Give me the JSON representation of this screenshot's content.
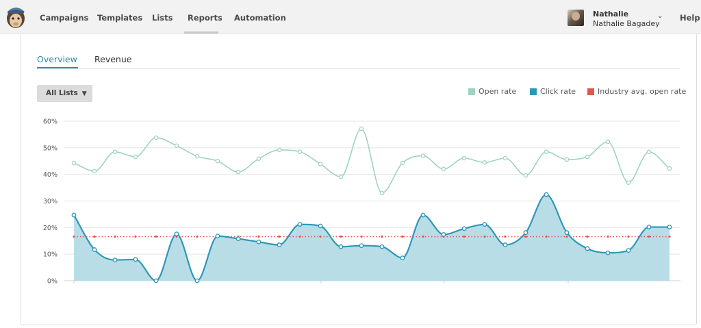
{
  "nav": {
    "items": [
      {
        "label": "Campaigns"
      },
      {
        "label": "Templates"
      },
      {
        "label": "Lists"
      },
      {
        "label": "Reports"
      },
      {
        "label": "Automation"
      }
    ],
    "active": "Reports",
    "help_label": "Help"
  },
  "user": {
    "first_name": "Nathalie",
    "full_name": "Nathalie Bagadey"
  },
  "tabs": [
    {
      "label": "Overview",
      "active": true
    },
    {
      "label": "Revenue",
      "active": false
    }
  ],
  "filter": {
    "selected": "All Lists"
  },
  "colors": {
    "open_rate": "#9fd3c1",
    "click_rate": "#2e97b7",
    "click_fill": "#b9dde7",
    "industry": "#e2574c",
    "accent": "#2f87a0"
  },
  "chart_data": {
    "type": "line",
    "title": "",
    "xlabel": "",
    "ylabel": "",
    "ylim": [
      0,
      60
    ],
    "yticks": [
      "0%",
      "10%",
      "20%",
      "30%",
      "40%",
      "50%",
      "60%"
    ],
    "grid": true,
    "legend_placement": "top-right",
    "x": [
      1,
      2,
      3,
      4,
      5,
      6,
      7,
      8,
      9,
      10,
      11,
      12,
      13,
      14,
      15,
      16,
      17,
      18,
      19,
      20,
      21,
      22,
      23,
      24,
      25,
      26,
      27,
      28,
      29,
      30
    ],
    "series": [
      {
        "name": "Open rate",
        "style": "line",
        "values": [
          44.3,
          41.2,
          48.5,
          46.6,
          53.8,
          50.8,
          46.8,
          45.0,
          40.9,
          45.9,
          49.2,
          48.5,
          43.9,
          39.1,
          57.2,
          33.0,
          44.3,
          47.0,
          42.0,
          46.1,
          44.5,
          46.1,
          39.6,
          48.5,
          45.6,
          46.6,
          52.3,
          36.9,
          48.5,
          42.2
        ]
      },
      {
        "name": "Click rate",
        "style": "area",
        "values": [
          24.7,
          11.7,
          7.8,
          8.0,
          0.0,
          17.6,
          0.0,
          16.8,
          15.8,
          14.6,
          13.5,
          21.2,
          20.6,
          12.8,
          13.2,
          12.8,
          8.6,
          24.7,
          17.4,
          19.6,
          21.2,
          13.5,
          18.1,
          32.4,
          18.1,
          12.1,
          10.5,
          11.4,
          20.2,
          20.2
        ]
      },
      {
        "name": "Industry avg. open rate",
        "style": "dotted",
        "values": [
          16.6,
          16.6,
          16.6,
          16.6,
          16.6,
          16.6,
          16.6,
          16.6,
          16.6,
          16.6,
          16.6,
          16.6,
          16.6,
          16.6,
          16.6,
          16.6,
          16.6,
          16.6,
          16.6,
          16.6,
          16.6,
          16.6,
          16.6,
          16.6,
          16.6,
          16.6,
          16.6,
          16.6,
          16.6,
          16.6
        ]
      }
    ]
  }
}
